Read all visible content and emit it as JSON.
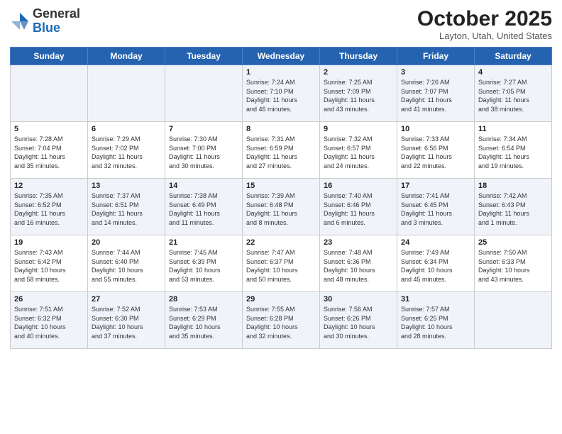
{
  "header": {
    "logo_general": "General",
    "logo_blue": "Blue",
    "month_title": "October 2025",
    "location": "Layton, Utah, United States"
  },
  "weekdays": [
    "Sunday",
    "Monday",
    "Tuesday",
    "Wednesday",
    "Thursday",
    "Friday",
    "Saturday"
  ],
  "weeks": [
    [
      {
        "day": "",
        "content": ""
      },
      {
        "day": "",
        "content": ""
      },
      {
        "day": "",
        "content": ""
      },
      {
        "day": "1",
        "content": "Sunrise: 7:24 AM\nSunset: 7:10 PM\nDaylight: 11 hours\nand 46 minutes."
      },
      {
        "day": "2",
        "content": "Sunrise: 7:25 AM\nSunset: 7:09 PM\nDaylight: 11 hours\nand 43 minutes."
      },
      {
        "day": "3",
        "content": "Sunrise: 7:26 AM\nSunset: 7:07 PM\nDaylight: 11 hours\nand 41 minutes."
      },
      {
        "day": "4",
        "content": "Sunrise: 7:27 AM\nSunset: 7:05 PM\nDaylight: 11 hours\nand 38 minutes."
      }
    ],
    [
      {
        "day": "5",
        "content": "Sunrise: 7:28 AM\nSunset: 7:04 PM\nDaylight: 11 hours\nand 35 minutes."
      },
      {
        "day": "6",
        "content": "Sunrise: 7:29 AM\nSunset: 7:02 PM\nDaylight: 11 hours\nand 32 minutes."
      },
      {
        "day": "7",
        "content": "Sunrise: 7:30 AM\nSunset: 7:00 PM\nDaylight: 11 hours\nand 30 minutes."
      },
      {
        "day": "8",
        "content": "Sunrise: 7:31 AM\nSunset: 6:59 PM\nDaylight: 11 hours\nand 27 minutes."
      },
      {
        "day": "9",
        "content": "Sunrise: 7:32 AM\nSunset: 6:57 PM\nDaylight: 11 hours\nand 24 minutes."
      },
      {
        "day": "10",
        "content": "Sunrise: 7:33 AM\nSunset: 6:56 PM\nDaylight: 11 hours\nand 22 minutes."
      },
      {
        "day": "11",
        "content": "Sunrise: 7:34 AM\nSunset: 6:54 PM\nDaylight: 11 hours\nand 19 minutes."
      }
    ],
    [
      {
        "day": "12",
        "content": "Sunrise: 7:35 AM\nSunset: 6:52 PM\nDaylight: 11 hours\nand 16 minutes."
      },
      {
        "day": "13",
        "content": "Sunrise: 7:37 AM\nSunset: 6:51 PM\nDaylight: 11 hours\nand 14 minutes."
      },
      {
        "day": "14",
        "content": "Sunrise: 7:38 AM\nSunset: 6:49 PM\nDaylight: 11 hours\nand 11 minutes."
      },
      {
        "day": "15",
        "content": "Sunrise: 7:39 AM\nSunset: 6:48 PM\nDaylight: 11 hours\nand 8 minutes."
      },
      {
        "day": "16",
        "content": "Sunrise: 7:40 AM\nSunset: 6:46 PM\nDaylight: 11 hours\nand 6 minutes."
      },
      {
        "day": "17",
        "content": "Sunrise: 7:41 AM\nSunset: 6:45 PM\nDaylight: 11 hours\nand 3 minutes."
      },
      {
        "day": "18",
        "content": "Sunrise: 7:42 AM\nSunset: 6:43 PM\nDaylight: 11 hours\nand 1 minute."
      }
    ],
    [
      {
        "day": "19",
        "content": "Sunrise: 7:43 AM\nSunset: 6:42 PM\nDaylight: 10 hours\nand 58 minutes."
      },
      {
        "day": "20",
        "content": "Sunrise: 7:44 AM\nSunset: 6:40 PM\nDaylight: 10 hours\nand 55 minutes."
      },
      {
        "day": "21",
        "content": "Sunrise: 7:45 AM\nSunset: 6:39 PM\nDaylight: 10 hours\nand 53 minutes."
      },
      {
        "day": "22",
        "content": "Sunrise: 7:47 AM\nSunset: 6:37 PM\nDaylight: 10 hours\nand 50 minutes."
      },
      {
        "day": "23",
        "content": "Sunrise: 7:48 AM\nSunset: 6:36 PM\nDaylight: 10 hours\nand 48 minutes."
      },
      {
        "day": "24",
        "content": "Sunrise: 7:49 AM\nSunset: 6:34 PM\nDaylight: 10 hours\nand 45 minutes."
      },
      {
        "day": "25",
        "content": "Sunrise: 7:50 AM\nSunset: 6:33 PM\nDaylight: 10 hours\nand 43 minutes."
      }
    ],
    [
      {
        "day": "26",
        "content": "Sunrise: 7:51 AM\nSunset: 6:32 PM\nDaylight: 10 hours\nand 40 minutes."
      },
      {
        "day": "27",
        "content": "Sunrise: 7:52 AM\nSunset: 6:30 PM\nDaylight: 10 hours\nand 37 minutes."
      },
      {
        "day": "28",
        "content": "Sunrise: 7:53 AM\nSunset: 6:29 PM\nDaylight: 10 hours\nand 35 minutes."
      },
      {
        "day": "29",
        "content": "Sunrise: 7:55 AM\nSunset: 6:28 PM\nDaylight: 10 hours\nand 32 minutes."
      },
      {
        "day": "30",
        "content": "Sunrise: 7:56 AM\nSunset: 6:26 PM\nDaylight: 10 hours\nand 30 minutes."
      },
      {
        "day": "31",
        "content": "Sunrise: 7:57 AM\nSunset: 6:25 PM\nDaylight: 10 hours\nand 28 minutes."
      },
      {
        "day": "",
        "content": ""
      }
    ]
  ]
}
